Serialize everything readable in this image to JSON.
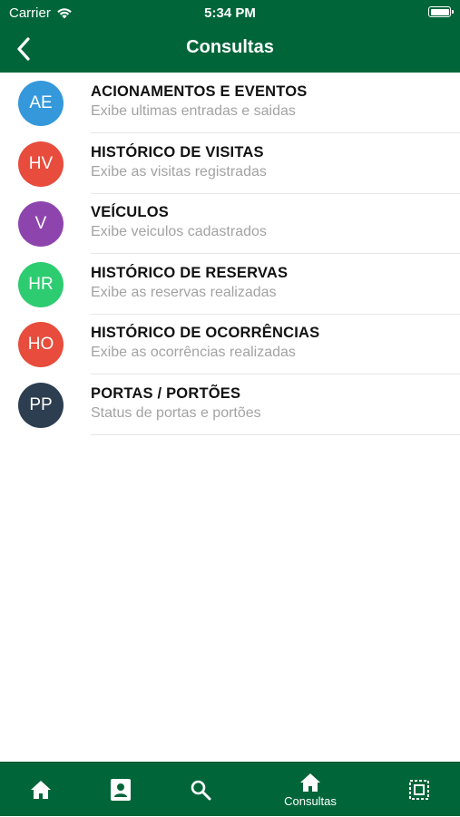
{
  "status_bar": {
    "carrier": "Carrier",
    "time": "5:34 PM"
  },
  "nav": {
    "title": "Consultas",
    "back_icon": "chevron-left-icon"
  },
  "items": [
    {
      "initials": "AE",
      "color": "#3498db",
      "title": "ACIONAMENTOS E EVENTOS",
      "subtitle": "Exibe ultimas entradas e saidas"
    },
    {
      "initials": "HV",
      "color": "#e74c3c",
      "title": "HISTÓRICO DE VISITAS",
      "subtitle": "Exibe as visitas registradas"
    },
    {
      "initials": "V",
      "color": "#8e44ad",
      "title": "VEÍCULOS",
      "subtitle": "Exibe veiculos cadastrados"
    },
    {
      "initials": "HR",
      "color": "#2ecc71",
      "title": "HISTÓRICO DE RESERVAS",
      "subtitle": "Exibe as reservas realizadas"
    },
    {
      "initials": "HO",
      "color": "#e74c3c",
      "title": "HISTÓRICO DE OCORRÊNCIAS",
      "subtitle": "Exibe as ocorrências realizadas"
    },
    {
      "initials": "PP",
      "color": "#2c3e50",
      "title": "PORTAS / PORTÕES",
      "subtitle": "Status de portas e portões"
    }
  ],
  "tabbar": {
    "bg_color": "#00663a",
    "tabs": [
      {
        "icon": "home-icon",
        "label": ""
      },
      {
        "icon": "contact-card-icon",
        "label": ""
      },
      {
        "icon": "search-icon",
        "label": ""
      },
      {
        "icon": "home-icon",
        "label": "Consultas"
      },
      {
        "icon": "scan-frame-icon",
        "label": ""
      }
    ]
  }
}
